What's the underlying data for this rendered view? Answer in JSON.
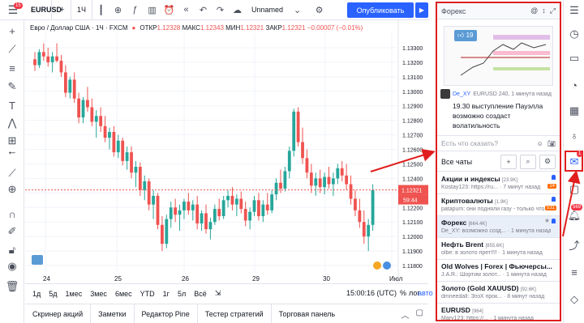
{
  "toolbar": {
    "menu_badge": "15",
    "symbol": "EURUSD",
    "interval": "1Ч",
    "layout_name": "Unnamed",
    "publish_label": "Опубликовать"
  },
  "legend": {
    "title": "Евро / Доллар США · 1Ч · FXCM",
    "open_label": "ОТКР",
    "open_value": "1.12328",
    "high_label": "МАКС",
    "high_value": "1.12343",
    "low_label": "МИН",
    "low_value": "1.12321",
    "close_label": "ЗАКР",
    "close_value": "1.12321",
    "change": "−0.00007 (−0.01%)"
  },
  "chart_data": {
    "type": "candlestick",
    "y_ticks": [
      "1.13300",
      "1.13200",
      "1.13100",
      "1.13000",
      "1.12900",
      "1.12800",
      "1.12700",
      "1.12600",
      "1.12500",
      "1.12400",
      "1.12300",
      "1.12200",
      "1.12100",
      "1.12000",
      "1.11900",
      "1.11800"
    ],
    "ylim": [
      1.1175,
      1.134
    ],
    "x_ticks": [
      "24",
      "25",
      "26",
      "29",
      "30",
      "Июл"
    ],
    "last_price_label": "1.12321",
    "countdown_label": "59:44",
    "last_price": 1.12321,
    "candles": [
      [
        1.1322,
        1.1327,
        1.1314,
        1.1318
      ],
      [
        1.1318,
        1.1329,
        1.1316,
        1.1327
      ],
      [
        1.1327,
        1.1333,
        1.1321,
        1.1324
      ],
      [
        1.1324,
        1.133,
        1.1317,
        1.132
      ],
      [
        1.132,
        1.1327,
        1.1313,
        1.1324
      ],
      [
        1.1324,
        1.1333,
        1.132,
        1.1321
      ],
      [
        1.1321,
        1.1325,
        1.131,
        1.1313
      ],
      [
        1.1313,
        1.1318,
        1.1296,
        1.1299
      ],
      [
        1.1299,
        1.131,
        1.1295,
        1.1308
      ],
      [
        1.1308,
        1.1313,
        1.1292,
        1.1295
      ],
      [
        1.1295,
        1.1299,
        1.1278,
        1.1282
      ],
      [
        1.1282,
        1.1296,
        1.1278,
        1.1294
      ],
      [
        1.1294,
        1.1303,
        1.1286,
        1.1289
      ],
      [
        1.1289,
        1.1295,
        1.1276,
        1.1279
      ],
      [
        1.1279,
        1.1287,
        1.1268,
        1.1283
      ],
      [
        1.1283,
        1.1289,
        1.1272,
        1.1276
      ],
      [
        1.1276,
        1.1283,
        1.1265,
        1.1268
      ],
      [
        1.1268,
        1.1275,
        1.126,
        1.1272
      ],
      [
        1.1272,
        1.1276,
        1.1255,
        1.1258
      ],
      [
        1.1258,
        1.127,
        1.1254,
        1.1266
      ],
      [
        1.1266,
        1.1268,
        1.1249,
        1.1252
      ],
      [
        1.1252,
        1.1262,
        1.1246,
        1.1258
      ],
      [
        1.1258,
        1.1262,
        1.124,
        1.1244
      ],
      [
        1.1244,
        1.1252,
        1.1234,
        1.1248
      ],
      [
        1.1248,
        1.1251,
        1.1228,
        1.1232
      ],
      [
        1.1232,
        1.1242,
        1.1225,
        1.1238
      ],
      [
        1.1238,
        1.124,
        1.1218,
        1.1222
      ],
      [
        1.1222,
        1.1232,
        1.1212,
        1.1228
      ],
      [
        1.1228,
        1.123,
        1.1205,
        1.1208
      ],
      [
        1.1208,
        1.1214,
        1.119,
        1.1195
      ],
      [
        1.1195,
        1.1215,
        1.1192,
        1.1212
      ],
      [
        1.1212,
        1.1224,
        1.1206,
        1.122
      ],
      [
        1.122,
        1.1226,
        1.121,
        1.1215
      ],
      [
        1.1215,
        1.1222,
        1.1204,
        1.1218
      ],
      [
        1.1218,
        1.1226,
        1.1212,
        1.1224
      ],
      [
        1.1224,
        1.123,
        1.1215,
        1.1218
      ],
      [
        1.1218,
        1.1225,
        1.1211,
        1.1222
      ],
      [
        1.1222,
        1.1228,
        1.1205,
        1.1209
      ],
      [
        1.1209,
        1.1218,
        1.1204,
        1.1216
      ],
      [
        1.1216,
        1.1222,
        1.1202,
        1.1205
      ],
      [
        1.1205,
        1.1213,
        1.1198,
        1.121
      ],
      [
        1.121,
        1.1222,
        1.1208,
        1.1219
      ],
      [
        1.1219,
        1.1226,
        1.1211,
        1.1214
      ],
      [
        1.1214,
        1.1228,
        1.1212,
        1.1225
      ],
      [
        1.1225,
        1.1232,
        1.122,
        1.1228
      ],
      [
        1.1228,
        1.1234,
        1.1218,
        1.1222
      ],
      [
        1.1222,
        1.1229,
        1.1214,
        1.1226
      ],
      [
        1.1226,
        1.1231,
        1.1216,
        1.1219
      ],
      [
        1.1219,
        1.1224,
        1.1207,
        1.1211
      ],
      [
        1.1211,
        1.122,
        1.1205,
        1.1217
      ],
      [
        1.1217,
        1.1228,
        1.1214,
        1.1225
      ],
      [
        1.1225,
        1.123,
        1.1211,
        1.1214
      ],
      [
        1.1214,
        1.1225,
        1.121,
        1.1222
      ],
      [
        1.1222,
        1.123,
        1.1215,
        1.1218
      ],
      [
        1.1218,
        1.1232,
        1.1216,
        1.1229
      ],
      [
        1.1229,
        1.124,
        1.1225,
        1.1237
      ],
      [
        1.1237,
        1.1246,
        1.123,
        1.1233
      ],
      [
        1.1233,
        1.1248,
        1.1231,
        1.1245
      ],
      [
        1.1245,
        1.1262,
        1.124,
        1.1259
      ],
      [
        1.1259,
        1.1288,
        1.1255,
        1.1286
      ],
      [
        1.1286,
        1.1289,
        1.1262,
        1.1265
      ],
      [
        1.1265,
        1.1275,
        1.125,
        1.1254
      ],
      [
        1.1254,
        1.126,
        1.124,
        1.1244
      ],
      [
        1.1244,
        1.125,
        1.123,
        1.1235
      ],
      [
        1.1235,
        1.1244,
        1.1228,
        1.124
      ],
      [
        1.124,
        1.1246,
        1.123,
        1.1234
      ],
      [
        1.1234,
        1.1244,
        1.1229,
        1.1241
      ],
      [
        1.1241,
        1.1248,
        1.1233,
        1.1236
      ],
      [
        1.1236,
        1.1244,
        1.1228,
        1.124
      ],
      [
        1.124,
        1.125,
        1.1236,
        1.1247
      ],
      [
        1.1247,
        1.1252,
        1.1238,
        1.1242
      ],
      [
        1.1242,
        1.125,
        1.1232,
        1.1236
      ],
      [
        1.1236,
        1.1242,
        1.1222,
        1.1226
      ],
      [
        1.1226,
        1.1232,
        1.1214,
        1.1218
      ],
      [
        1.1218,
        1.1226,
        1.1206,
        1.121
      ],
      [
        1.121,
        1.1218,
        1.1195,
        1.12
      ],
      [
        1.12,
        1.1212,
        1.119,
        1.1208
      ],
      [
        1.1208,
        1.1236,
        1.1204,
        1.1232
      ]
    ]
  },
  "left_icon_names": [
    "crosshair-icon",
    "trend-line-icon",
    "fib-icon",
    "brush-icon",
    "text-icon",
    "pattern-icon",
    "forecast-icon",
    "arrow-left-icon",
    "ruler-icon",
    "zoom-icon",
    "magnet-icon",
    "lock-draw-icon",
    "unlock-icon",
    "eye-icon",
    "trash-icon"
  ],
  "timeframes": [
    "1д",
    "5д",
    "1мес",
    "3мес",
    "6мес",
    "YTD",
    "1г",
    "5л",
    "Всё"
  ],
  "clock": "15:00:16 (UTC)",
  "pct": "%",
  "log": "лог",
  "auto": "авто",
  "panel_tabs": [
    "Скринер акций",
    "Заметки",
    "Редактор Pine",
    "Тестер стратегий",
    "Торговая панель"
  ],
  "chat": {
    "header": "Форекс",
    "idea_likes": "19",
    "msg_user": "De_XY",
    "msg_meta": "EURUSD 240, 1 минута назад",
    "msg_text": "19.30 выступление Пауэлла возможно создаст волатильность",
    "input_placeholder": "Есть что сказать?",
    "list_title": "Все чаты",
    "chats": [
      {
        "title": "Акции и индексы",
        "count": "[23.9K]",
        "sub": "Kostay123: https://ru...  · 7 минут назад",
        "badge": "14",
        "active": false
      },
      {
        "title": "Криптовалюты",
        "count": "[1.9K]",
        "sub": "patapum: они подняли газу - только что",
        "badge": "531",
        "active": false
      },
      {
        "title": "Форекс",
        "count": "[664.4K]",
        "sub": "De_XY: возможно созд... · 1 минута назад",
        "badge": "",
        "active": true
      },
      {
        "title": "Нефть Brent",
        "count": "[855.6K]",
        "sub": "olbe: в золото прет!!!! · 1 минута назад",
        "badge": "",
        "active": false
      },
      {
        "title": "Old Wolves | Forex | Фьючерсы...",
        "count": "",
        "sub": "J.A.R.: Шортим золот... · 1 минута назад",
        "badge": "",
        "active": false
      },
      {
        "title": "Золото (Gold XAUUSD)",
        "count": "[92.6K]",
        "sub": "dmneedall: ЭэзХ прок... · 8 минут назад",
        "badge": "",
        "active": false
      },
      {
        "title": "EURUSD",
        "count": "[964]",
        "sub": "Mary123: https://... · 1 минута назад",
        "badge": "",
        "active": false
      }
    ]
  },
  "rail": {
    "chat_badge": "1",
    "notif_badge": "569"
  },
  "colors": {
    "up": "#26a69a",
    "down": "#ef5350",
    "accent": "#2962ff",
    "annotation": "#e01e1e"
  }
}
